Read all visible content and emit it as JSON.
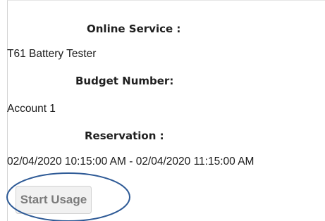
{
  "online_service": {
    "label": "Online Service :",
    "value": "T61 Battery Tester"
  },
  "budget_number": {
    "label": "Budget Number:",
    "value": "Account 1"
  },
  "reservation": {
    "label": "Reservation :",
    "value": "02/04/2020 10:15:00 AM - 02/04/2020 11:15:00 AM"
  },
  "actions": {
    "start_usage_label": "Start Usage"
  },
  "annotation": {
    "color": "#2e5a96",
    "shape": "ellipse"
  }
}
